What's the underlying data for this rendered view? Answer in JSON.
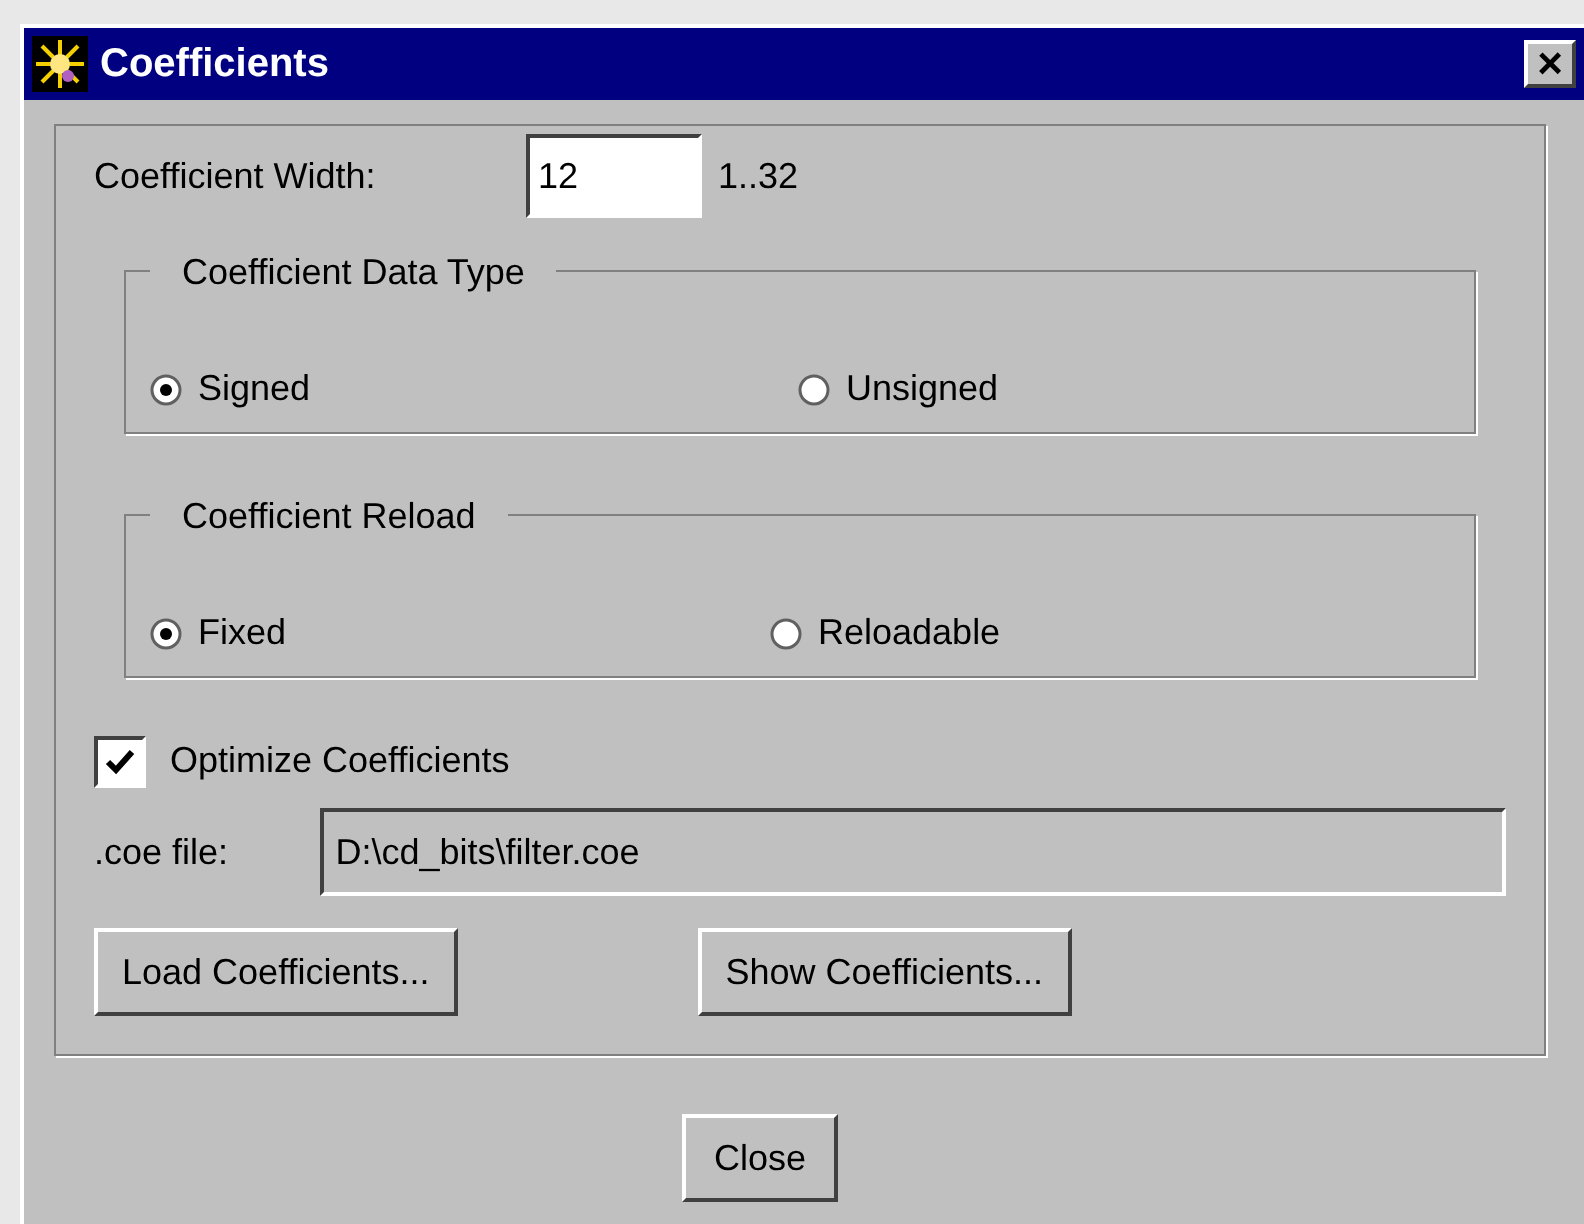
{
  "window": {
    "title": "Coefficients",
    "close_glyph": "×"
  },
  "coefficient_width": {
    "label": "Coefficient Width:",
    "value": "12",
    "range": "1..32"
  },
  "groups": [
    {
      "title": "Coefficient Data Type",
      "options": [
        {
          "label": "Signed",
          "selected": true
        },
        {
          "label": "Unsigned",
          "selected": false
        }
      ]
    },
    {
      "title": "Coefficient Reload",
      "options": [
        {
          "label": "Fixed",
          "selected": true
        },
        {
          "label": "Reloadable",
          "selected": false
        }
      ]
    }
  ],
  "optimize": {
    "label": "Optimize Coefficients",
    "checked": true
  },
  "coe_file": {
    "label": ".coe file:",
    "value": "D:\\cd_bits\\filter.coe"
  },
  "buttons": [
    "Load Coefficients...",
    "Show Coefficients..."
  ],
  "close_button": "Close"
}
